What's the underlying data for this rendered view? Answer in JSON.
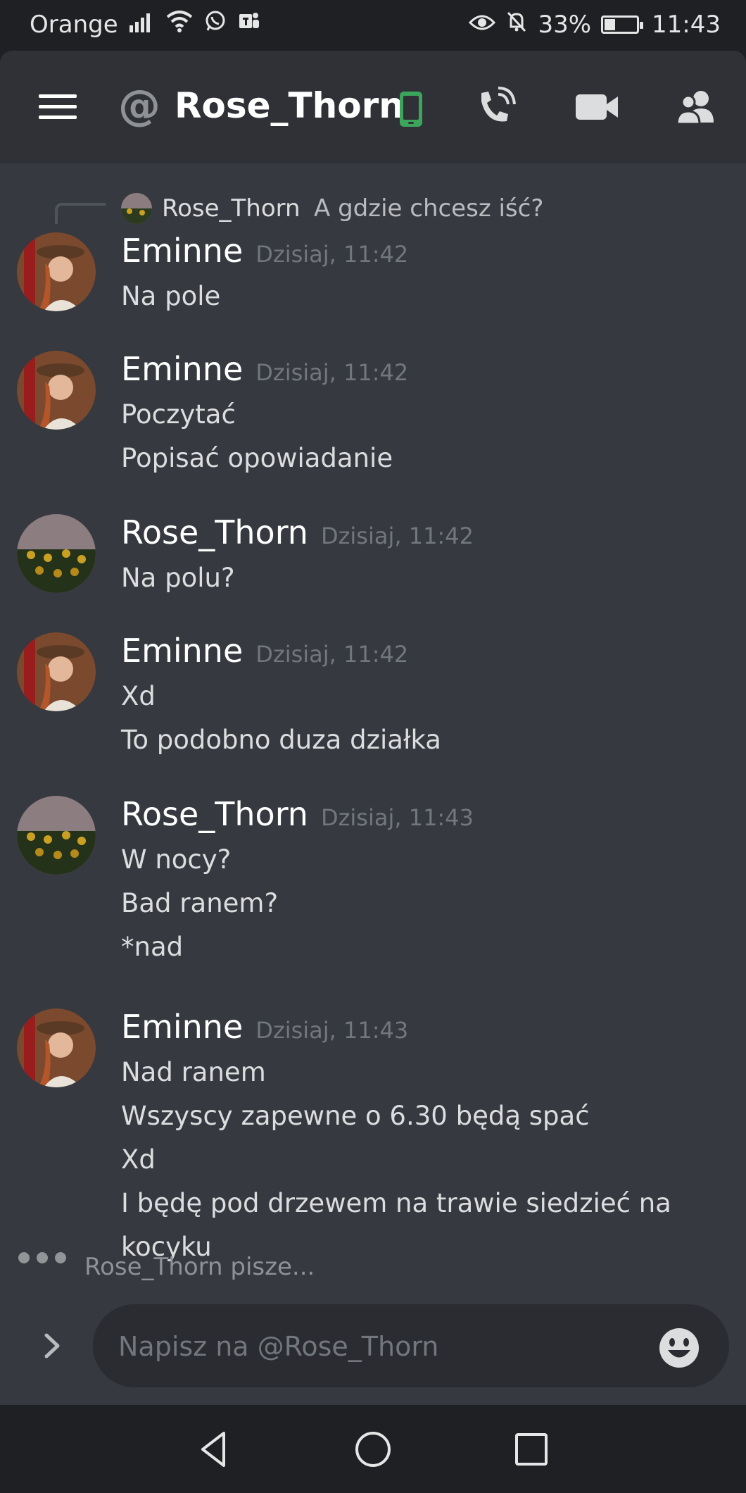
{
  "status_bar": {
    "carrier": "Orange",
    "battery": "33%",
    "battery_level": 0.33,
    "time": "11:43"
  },
  "header": {
    "title": "Rose_Thorn",
    "icons": [
      "menu-icon",
      "at-icon",
      "mobile-icon",
      "call-icon",
      "video-icon",
      "members-icon"
    ]
  },
  "reply": {
    "author": "Rose_Thorn",
    "text": "A gdzie chcesz iść?"
  },
  "messages": [
    {
      "author": "Eminne",
      "time": "Dzisiaj, 11:42",
      "lines": [
        "Na pole"
      ]
    },
    {
      "author": "Eminne",
      "time": "Dzisiaj, 11:42",
      "lines": [
        "Poczytać",
        "Popisać opowiadanie"
      ]
    },
    {
      "author": "Rose_Thorn",
      "time": "Dzisiaj, 11:42",
      "lines": [
        "Na polu?"
      ]
    },
    {
      "author": "Eminne",
      "time": "Dzisiaj, 11:42",
      "lines": [
        "Xd",
        "To podobno duza działka"
      ]
    },
    {
      "author": "Rose_Thorn",
      "time": "Dzisiaj, 11:43",
      "lines": [
        "W nocy?",
        "Bad ranem?",
        "*nad"
      ]
    },
    {
      "author": "Eminne",
      "time": "Dzisiaj, 11:43",
      "lines": [
        "Nad ranem",
        "Wszyscy zapewne o 6.30 będą spać",
        "Xd",
        "I będę pod drzewem na trawie siedzieć na",
        "kocyku"
      ]
    }
  ],
  "typing": {
    "text": "Rose_Thorn pisze..."
  },
  "composer": {
    "placeholder": "Napisz na @Rose_Thorn"
  },
  "colors": {
    "background": "#36393f",
    "header": "#2f3136",
    "online_green": "#3ba55c",
    "input": "#2a2c31"
  }
}
